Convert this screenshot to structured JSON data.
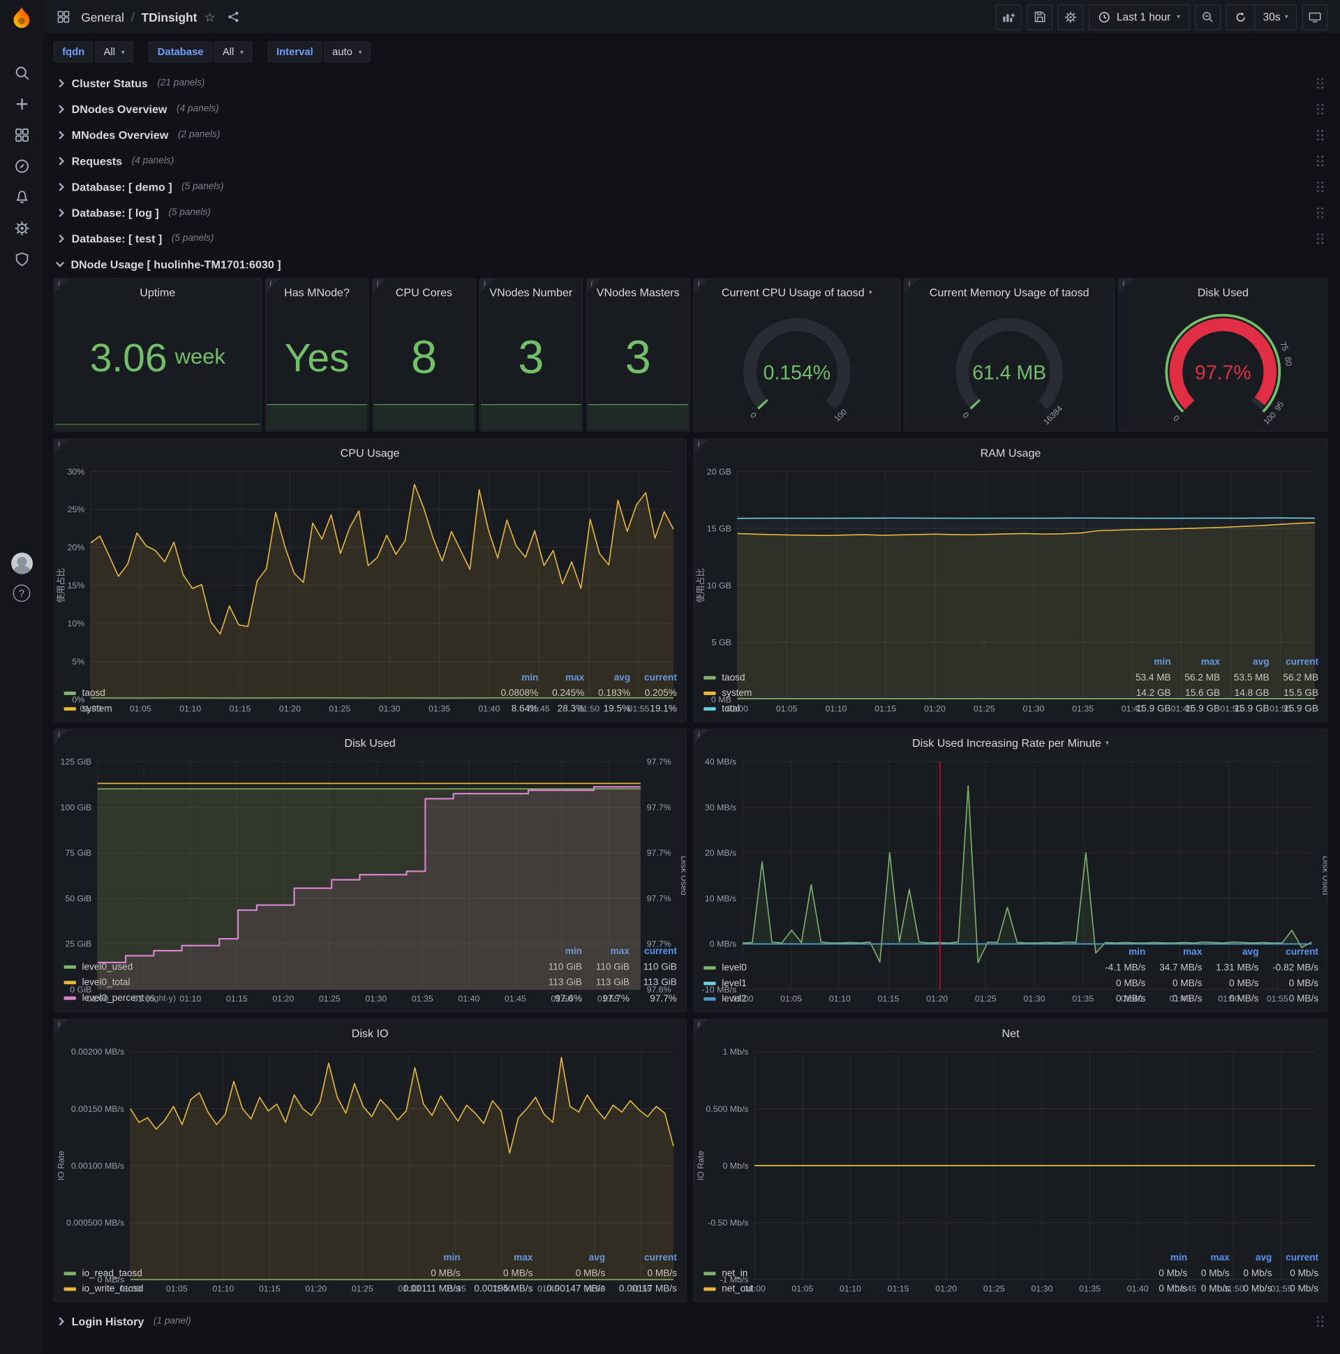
{
  "nav": {
    "breadcrumb_section": "General",
    "breadcrumb_sep": "/",
    "breadcrumb_page": "TDinsight",
    "time_range": "Last 1 hour",
    "refresh_interval": "30s"
  },
  "variables": [
    {
      "label": "fqdn",
      "value": "All"
    },
    {
      "label": "Database",
      "value": "All"
    },
    {
      "label": "Interval",
      "value": "auto"
    }
  ],
  "rows": {
    "cluster": {
      "title": "Cluster Status",
      "count": "(21 panels)"
    },
    "dnodes": {
      "title": "DNodes Overview",
      "count": "(4 panels)"
    },
    "mnodes": {
      "title": "MNodes Overview",
      "count": "(2 panels)"
    },
    "requests": {
      "title": "Requests",
      "count": "(4 panels)"
    },
    "db_demo": {
      "title": "Database: [ demo ]",
      "count": "(5 panels)"
    },
    "db_log": {
      "title": "Database: [ log ]",
      "count": "(5 panels)"
    },
    "db_test": {
      "title": "Database: [ test ]",
      "count": "(5 panels)"
    },
    "dnode_usage": {
      "title": "DNode Usage [ huolinhe-TM1701:6030 ]"
    },
    "login": {
      "title": "Login History",
      "count": "(1 panel)"
    }
  },
  "stats": {
    "uptime": {
      "title": "Uptime",
      "value": "3.06",
      "unit": "week"
    },
    "has_mnode": {
      "title": "Has MNode?",
      "value": "Yes"
    },
    "cpu_cores": {
      "title": "CPU Cores",
      "value": "8"
    },
    "vnodes_number": {
      "title": "VNodes Number",
      "value": "3"
    },
    "vnodes_masters": {
      "title": "VNodes Masters",
      "value": "3"
    }
  },
  "gauges": {
    "cpu": {
      "title": "Current CPU Usage of taosd",
      "value": "0.154%",
      "fraction": 0.00154,
      "color": "#73bf69",
      "labels": [
        {
          "text": "0",
          "f": 0
        },
        {
          "text": "100",
          "f": 1
        }
      ]
    },
    "mem": {
      "title": "Current Memory Usage of taosd",
      "value": "61.4 MB",
      "fraction": 0.00375,
      "color": "#73bf69",
      "labels": [
        {
          "text": "0",
          "f": 0
        },
        {
          "text": "16384",
          "f": 1
        }
      ]
    },
    "disk": {
      "title": "Disk Used",
      "value": "97.7%",
      "fraction": 0.977,
      "color": "#e02f44",
      "value_color": "#e02f44",
      "ring": true,
      "labels": [
        {
          "text": "0",
          "f": 0
        },
        {
          "text": "75",
          "f": 0.75
        },
        {
          "text": "80",
          "f": 0.8
        },
        {
          "text": "95",
          "f": 0.95
        },
        {
          "text": "100",
          "f": 1
        }
      ]
    }
  },
  "charts": {
    "cpu": {
      "type": "line",
      "title": "CPU Usage",
      "ylabel": "使用占比",
      "ylim": [
        0,
        30
      ],
      "yticks": [
        "0%",
        "5%",
        "10%",
        "15%",
        "20%",
        "25%",
        "30%"
      ],
      "xticks": [
        "01:00",
        "01:05",
        "01:10",
        "01:15",
        "01:20",
        "01:25",
        "01:30",
        "01:35",
        "01:40",
        "01:45",
        "01:50",
        "01:55"
      ],
      "ml": 42,
      "mr": 14,
      "series": [
        {
          "name": "system",
          "color": "#eab839",
          "fill": true,
          "fill_opacity": 0.12,
          "values": [
            20.6,
            21.5,
            18.9,
            16.2,
            17.8,
            21.9,
            20.2,
            19.6,
            18.1,
            20.7,
            16.4,
            14.6,
            15.1,
            10.2,
            8.6,
            12.3,
            9.8,
            9.6,
            15.6,
            17.2,
            24.6,
            20.1,
            16.6,
            15.4,
            23.2,
            21.1,
            24.3,
            19.2,
            22.6,
            24.8,
            17.6,
            18.7,
            21.6,
            19.1,
            20.9,
            28.3,
            25.2,
            21.3,
            18.2,
            22.1,
            19.6,
            17.1,
            27.6,
            22.3,
            18.6,
            23.6,
            20.2,
            18.7,
            22.2,
            17.6,
            19.6,
            15.2,
            18.1,
            14.6,
            23.7,
            19.2,
            17.7,
            26.2,
            22.1,
            25.6,
            27.2,
            21.2,
            24.7,
            22.4
          ]
        },
        {
          "name": "taosd",
          "color": "#7eb26d",
          "values": [
            0.2,
            0.18,
            0.21,
            0.19,
            0.2,
            0.22,
            0.19,
            0.2,
            0.18,
            0.21,
            0.2,
            0.19,
            0.21,
            0.2
          ]
        }
      ],
      "legend": {
        "headers": [
          "min",
          "max",
          "avg",
          "current"
        ],
        "rows": [
          {
            "name": "taosd",
            "color": "#7eb26d",
            "values": [
              "0.0808%",
              "0.245%",
              "0.183%",
              "0.205%"
            ]
          },
          {
            "name": "system",
            "color": "#eab839",
            "values": [
              "8.64%",
              "28.3%",
              "19.5%",
              "19.1%"
            ]
          }
        ]
      }
    },
    "ram": {
      "type": "line",
      "title": "RAM Usage",
      "ylabel": "使用占比",
      "ylim": [
        0,
        20
      ],
      "yticks": [
        "0 MB",
        "5 GB",
        "10 GB",
        "15 GB",
        "20 GB"
      ],
      "xticks": [
        "01:00",
        "01:05",
        "01:10",
        "01:15",
        "01:20",
        "01:25",
        "01:30",
        "01:35",
        "01:40",
        "01:45",
        "01:50",
        "01:55"
      ],
      "ml": 50,
      "mr": 14,
      "series": [
        {
          "name": "taosd",
          "color": "#7eb26d",
          "fill": true,
          "fill_opacity": 0.1,
          "values": [
            0.053,
            0.054,
            0.053,
            0.055,
            0.054,
            0.053,
            0.055,
            0.056
          ]
        },
        {
          "name": "system",
          "color": "#eab839",
          "fill": true,
          "fill_opacity": 0.1,
          "values": [
            14.55,
            14.5,
            14.45,
            14.42,
            14.4,
            14.38,
            14.42,
            14.45,
            14.4,
            14.43,
            14.47,
            14.5,
            14.46,
            14.44,
            14.48,
            14.52,
            14.55,
            14.5,
            14.53,
            14.6,
            14.8,
            14.85,
            14.9,
            14.92,
            14.95,
            15.0,
            15.05,
            15.1,
            15.18,
            15.25,
            15.35,
            15.45,
            15.5
          ]
        },
        {
          "name": "total",
          "color": "#6ed0e0",
          "fill": true,
          "fill_opacity": 0.04,
          "values": [
            15.88,
            15.9,
            15.89,
            15.9,
            15.91,
            15.9,
            15.89,
            15.9,
            15.9,
            15.91,
            15.9,
            15.89,
            15.9,
            15.9,
            15.92,
            15.9
          ]
        }
      ],
      "legend": {
        "headers": [
          "min",
          "max",
          "avg",
          "current"
        ],
        "rows": [
          {
            "name": "taosd",
            "color": "#7eb26d",
            "values": [
              "53.4 MB",
              "56.2 MB",
              "53.5 MB",
              "56.2 MB"
            ]
          },
          {
            "name": "system",
            "color": "#eab839",
            "values": [
              "14.2 GB",
              "15.6 GB",
              "14.8 GB",
              "15.5 GB"
            ]
          },
          {
            "name": "total",
            "color": "#6ed0e0",
            "values": [
              "15.9 GB",
              "15.9 GB",
              "15.9 GB",
              "15.9 GB"
            ]
          }
        ]
      }
    },
    "disk_used": {
      "type": "line",
      "title": "Disk Used",
      "ylabel_right": "Disk Used",
      "ylim": [
        0,
        125
      ],
      "yticks": [
        "0 GiB",
        "25 GiB",
        "50 GiB",
        "75 GiB",
        "100 GiB",
        "125 GiB"
      ],
      "right_ylim": [
        97.58,
        97.715
      ],
      "right_ticks": [
        "97.6%",
        "97.7%",
        "97.7%",
        "97.7%",
        "97.7%",
        "97.7%"
      ],
      "xticks": [
        "01:00",
        "01:05",
        "01:10",
        "01:15",
        "01:20",
        "01:25",
        "01:30",
        "01:35",
        "01:40",
        "01:45",
        "01:50",
        "01:55"
      ],
      "ml": 50,
      "mr": 52,
      "series": [
        {
          "name": "level0_used",
          "color": "#7eb26d",
          "fill": true,
          "fill_opacity": 0.14,
          "values": [
            110,
            110
          ]
        },
        {
          "name": "level0_total",
          "color": "#eab839",
          "fill": true,
          "fill_opacity": 0.05,
          "values": [
            113,
            113
          ]
        },
        {
          "name": "level0_percent",
          "color": "#d683ce",
          "right": true,
          "step": true,
          "width": 1.8,
          "fill": true,
          "fill_opacity": 0.1,
          "values": [
            97.596,
            97.596,
            97.596,
            97.6,
            97.6,
            97.6,
            97.603,
            97.603,
            97.603,
            97.606,
            97.606,
            97.606,
            97.606,
            97.61,
            97.61,
            97.627,
            97.627,
            97.63,
            97.63,
            97.63,
            97.63,
            97.64,
            97.64,
            97.64,
            97.64,
            97.645,
            97.645,
            97.645,
            97.648,
            97.648,
            97.648,
            97.648,
            97.648,
            97.65,
            97.65,
            97.693,
            97.693,
            97.693,
            97.696,
            97.696,
            97.696,
            97.696,
            97.696,
            97.696,
            97.696,
            97.696,
            97.698,
            97.698,
            97.698,
            97.698,
            97.698,
            97.698,
            97.698,
            97.7,
            97.7,
            97.7,
            97.7,
            97.7,
            97.7
          ]
        }
      ],
      "legend": {
        "headers": [
          "min",
          "max",
          "current"
        ],
        "rows": [
          {
            "name": "level0_used",
            "color": "#7eb26d",
            "values": [
              "110 GiB",
              "110 GiB",
              "110 GiB"
            ]
          },
          {
            "name": "level0_total",
            "color": "#eab839",
            "values": [
              "113 GiB",
              "113 GiB",
              "113 GiB"
            ]
          },
          {
            "name": "level0_percent",
            "color": "#d683ce",
            "suffix": "(right-y)",
            "values": [
              "97.6%",
              "97.7%",
              "97.7%"
            ]
          }
        ]
      }
    },
    "disk_rate": {
      "type": "line",
      "title": "Disk Used Increasing Rate per Minute",
      "has_menu": true,
      "ylabel_right": "Disk Used",
      "ylim": [
        -10,
        40
      ],
      "yticks": [
        "-10 MB/s",
        "0 MB/s",
        "10 MB/s",
        "20 MB/s",
        "30 MB/s",
        "40 MB/s"
      ],
      "xticks": [
        "01:00",
        "01:05",
        "01:10",
        "01:15",
        "01:20",
        "01:25",
        "01:30",
        "01:35",
        "01:40",
        "01:45",
        "01:50",
        "01:55"
      ],
      "ml": 56,
      "mr": 18,
      "annotation_x": 20.3,
      "series": [
        {
          "name": "level0",
          "color": "#7eb26d",
          "fill": true,
          "fill_opacity": 0.1,
          "values": [
            0.2,
            0.3,
            18,
            0.4,
            0.2,
            3,
            0.3,
            13,
            0.4,
            0.2,
            0.2,
            0.3,
            0.2,
            0.4,
            -4,
            20,
            0.4,
            12,
            0.4,
            0.2,
            0.3,
            0.2,
            0.4,
            34.7,
            -4.1,
            0.4,
            0.3,
            8,
            0.3,
            0.2,
            0.2,
            0.3,
            0.2,
            0.4,
            0.3,
            20,
            -2,
            0.3,
            0.2,
            0.3,
            0.2,
            0.2,
            0.3,
            0.2,
            0.2,
            0.3,
            0.2,
            0.4,
            0.3,
            0.2,
            0.4,
            0.3,
            0.2,
            0.3,
            0.2,
            0.2,
            3,
            -0.8,
            0.4
          ]
        },
        {
          "name": "level1",
          "color": "#6ed0e0",
          "values": [
            0,
            0
          ]
        },
        {
          "name": "level2",
          "color": "#5195ce",
          "values": [
            0,
            0
          ]
        }
      ],
      "legend": {
        "headers": [
          "min",
          "max",
          "avg",
          "current"
        ],
        "rows": [
          {
            "name": "level0",
            "color": "#7eb26d",
            "values": [
              "-4.1 MB/s",
              "34.7 MB/s",
              "1.31 MB/s",
              "-0.82 MB/s"
            ]
          },
          {
            "name": "level1",
            "color": "#6ed0e0",
            "values": [
              "0 MB/s",
              "0 MB/s",
              "0 MB/s",
              "0 MB/s"
            ]
          },
          {
            "name": "level2",
            "color": "#5195ce",
            "values": [
              "0 MB/s",
              "0 MB/s",
              "0 MB/s",
              "0 MB/s"
            ]
          }
        ]
      }
    },
    "disk_io": {
      "type": "line",
      "title": "Disk IO",
      "ylabel": "IO Rate",
      "ylim": [
        0,
        0.002
      ],
      "yticks": [
        "0 MB/s",
        "0.000500 MB/s",
        "0.00100 MB/s",
        "0.00150 MB/s",
        "0.00200 MB/s"
      ],
      "xticks": [
        "01:00",
        "01:05",
        "01:10",
        "01:15",
        "01:20",
        "01:25",
        "01:30",
        "01:35",
        "01:40",
        "01:45",
        "01:50",
        "01:55"
      ],
      "ml": 88,
      "mr": 14,
      "series": [
        {
          "name": "io_read_taosd",
          "color": "#7eb26d",
          "values": [
            0,
            0
          ]
        },
        {
          "name": "io_write_taosd",
          "color": "#eab839",
          "fill": true,
          "fill_opacity": 0.12,
          "values": [
            0.0015,
            0.00138,
            0.00142,
            0.00132,
            0.0014,
            0.00152,
            0.00136,
            0.00158,
            0.00164,
            0.00147,
            0.00136,
            0.00145,
            0.00174,
            0.0015,
            0.00141,
            0.0016,
            0.00148,
            0.00154,
            0.00138,
            0.00162,
            0.0015,
            0.00144,
            0.00156,
            0.0019,
            0.0016,
            0.00146,
            0.00172,
            0.00152,
            0.00143,
            0.00158,
            0.0015,
            0.0014,
            0.00148,
            0.00186,
            0.00154,
            0.00144,
            0.00161,
            0.0015,
            0.00139,
            0.00153,
            0.00146,
            0.00137,
            0.00157,
            0.00148,
            0.00111,
            0.00142,
            0.0015,
            0.0016,
            0.00145,
            0.00138,
            0.00195,
            0.00152,
            0.00147,
            0.00162,
            0.0015,
            0.00141,
            0.00153,
            0.00147,
            0.00157,
            0.00149,
            0.00143,
            0.00152,
            0.00146,
            0.00117
          ]
        }
      ],
      "legend": {
        "headers": [
          "min",
          "max",
          "avg",
          "current"
        ],
        "rows": [
          {
            "name": "io_read_taosd",
            "color": "#7eb26d",
            "values": [
              "0 MB/s",
              "0 MB/s",
              "0 MB/s",
              "0 MB/s"
            ]
          },
          {
            "name": "io_write_taosd",
            "color": "#eab839",
            "values": [
              "0.00111 MB/s",
              "0.00195 MB/s",
              "0.00147 MB/s",
              "0.00117 MB/s"
            ]
          }
        ]
      }
    },
    "net": {
      "type": "line",
      "title": "Net",
      "ylabel": "IO Rate",
      "ylim": [
        -1,
        1
      ],
      "yticks": [
        "-1 Mb/s",
        "-0.50 Mb/s",
        "0 Mb/s",
        "0.500 Mb/s",
        "1 Mb/s"
      ],
      "xticks": [
        "01:00",
        "01:05",
        "01:10",
        "01:15",
        "01:20",
        "01:25",
        "01:30",
        "01:35",
        "01:40",
        "01:45",
        "01:50",
        "01:55"
      ],
      "ml": 70,
      "mr": 14,
      "series": [
        {
          "name": "net_in",
          "color": "#7eb26d",
          "values": [
            0,
            0
          ]
        },
        {
          "name": "net_out",
          "color": "#eab839",
          "values": [
            0,
            0
          ]
        }
      ],
      "legend": {
        "headers": [
          "min",
          "max",
          "avg",
          "current"
        ],
        "rows": [
          {
            "name": "net_in",
            "color": "#7eb26d",
            "values": [
              "0 Mb/s",
              "0 Mb/s",
              "0 Mb/s",
              "0 Mb/s"
            ]
          },
          {
            "name": "net_out",
            "color": "#eab839",
            "values": [
              "0 Mb/s",
              "0 Mb/s",
              "0 Mb/s",
              "0 Mb/s"
            ]
          }
        ]
      }
    }
  },
  "colors": {
    "green": "#73bf69",
    "yellow": "#eab839",
    "blue": "#6ed0e0",
    "pink": "#d683ce",
    "red": "#e02f44",
    "annotation_red": "#c4162a",
    "legend_header_blue": "#5794f2"
  }
}
